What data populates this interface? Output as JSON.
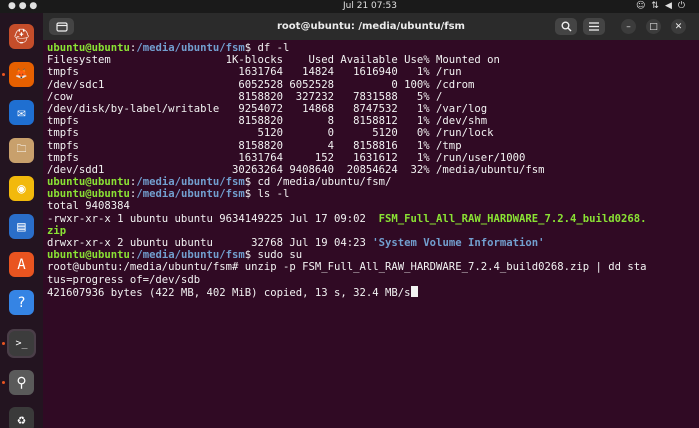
{
  "topbar": {
    "clock": "Jul 21  07:53"
  },
  "dock": {
    "items": [
      {
        "name": "help-icon-top",
        "glyph": "⛑",
        "bg": "#c44d2a"
      },
      {
        "name": "firefox-icon",
        "glyph": "🦊",
        "bg": "#e66000"
      },
      {
        "name": "thunderbird-icon",
        "glyph": "✉",
        "bg": "#1f6fd1"
      },
      {
        "name": "files-icon",
        "glyph": "🗀",
        "bg": "#c8a06c"
      },
      {
        "name": "rhythmbox-icon",
        "glyph": "◉",
        "bg": "#f2b90c"
      },
      {
        "name": "writer-icon",
        "glyph": "▤",
        "bg": "#2a6ec9"
      },
      {
        "name": "appcenter-icon",
        "glyph": "A",
        "bg": "#e95420"
      },
      {
        "name": "help-icon",
        "glyph": "?",
        "bg": "#3584e4"
      },
      {
        "name": "terminal-icon",
        "glyph": ">_",
        "bg": "#3c3c3c"
      },
      {
        "name": "usb-drive-icon",
        "glyph": "⚲",
        "bg": "#5a5a5a"
      },
      {
        "name": "trash-icon",
        "glyph": "♻",
        "bg": "#3a3a3a"
      }
    ]
  },
  "window": {
    "title": "root@ubuntu: /media/ubuntu/fsm"
  },
  "terminal": {
    "lines": [
      [
        {
          "t": "ubuntu@ubuntu",
          "c": "user"
        },
        {
          "t": ":",
          "c": "root"
        },
        {
          "t": "/media/ubuntu/fsm",
          "c": "path"
        },
        {
          "t": "$ df -l",
          "c": "root"
        }
      ],
      [
        {
          "t": "Filesystem                  1K-blocks    Used Available Use% Mounted on",
          "c": "root"
        }
      ],
      [
        {
          "t": "tmpfs                         1631764   14824   1616940   1% /run",
          "c": "root"
        }
      ],
      [
        {
          "t": "/dev/sdc1                     6052528 6052528         0 100% /cdrom",
          "c": "root"
        }
      ],
      [
        {
          "t": "/cow                          8158820  327232   7831588   5% /",
          "c": "root"
        }
      ],
      [
        {
          "t": "/dev/disk/by-label/writable   9254072   14868   8747532   1% /var/log",
          "c": "root"
        }
      ],
      [
        {
          "t": "tmpfs                         8158820       8   8158812   1% /dev/shm",
          "c": "root"
        }
      ],
      [
        {
          "t": "tmpfs                            5120       0      5120   0% /run/lock",
          "c": "root"
        }
      ],
      [
        {
          "t": "tmpfs                         8158820       4   8158816   1% /tmp",
          "c": "root"
        }
      ],
      [
        {
          "t": "tmpfs                         1631764     152   1631612   1% /run/user/1000",
          "c": "root"
        }
      ],
      [
        {
          "t": "/dev/sdd1                    30263264 9408640  20854624  32% /media/ubuntu/fsm",
          "c": "root"
        }
      ],
      [
        {
          "t": "ubuntu@ubuntu",
          "c": "user"
        },
        {
          "t": ":",
          "c": "root"
        },
        {
          "t": "/media/ubuntu/fsm",
          "c": "path"
        },
        {
          "t": "$ cd /media/ubuntu/fsm/",
          "c": "root"
        }
      ],
      [
        {
          "t": "ubuntu@ubuntu",
          "c": "user"
        },
        {
          "t": ":",
          "c": "root"
        },
        {
          "t": "/media/ubuntu/fsm",
          "c": "path"
        },
        {
          "t": "$ ls -l",
          "c": "root"
        }
      ],
      [
        {
          "t": "total 9408384",
          "c": "root"
        }
      ],
      [
        {
          "t": "-rwxr-xr-x 1 ubuntu ubuntu 9634149225 Jul 17 09:02  ",
          "c": "root"
        },
        {
          "t": "FSM_Full_All_RAW_HARDWARE_7.2.4_build0268.",
          "c": "exec"
        }
      ],
      [
        {
          "t": "zip",
          "c": "exec"
        }
      ],
      [
        {
          "t": "drwxr-xr-x 2 ubuntu ubuntu      32768 Jul 19 04:23 ",
          "c": "root"
        },
        {
          "t": "'System Volume Information'",
          "c": "dir"
        }
      ],
      [
        {
          "t": "ubuntu@ubuntu",
          "c": "user"
        },
        {
          "t": ":",
          "c": "root"
        },
        {
          "t": "/media/ubuntu/fsm",
          "c": "path"
        },
        {
          "t": "$ sudo su",
          "c": "root"
        }
      ],
      [
        {
          "t": "root@ubuntu:/media/ubuntu/fsm# unzip -p FSM_Full_All_RAW_HARDWARE_7.2.4_build0268.zip | dd sta",
          "c": "root"
        }
      ],
      [
        {
          "t": "tus=progress of=/dev/sdb",
          "c": "root"
        }
      ],
      [
        {
          "t": "421607936 bytes (422 MB, 402 MiB) copied, 13 s, 32.4 MB/s",
          "c": "root"
        }
      ]
    ]
  }
}
